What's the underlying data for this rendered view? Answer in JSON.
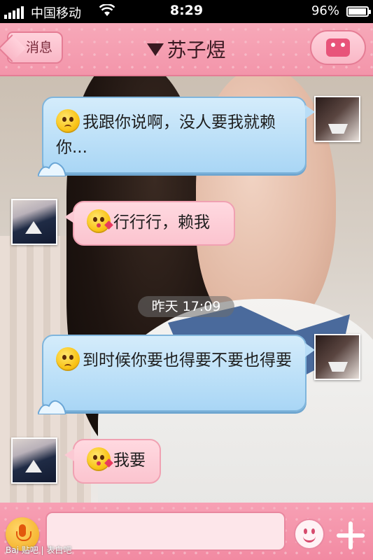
{
  "status_bar": {
    "carrier": "中国移动",
    "time": "8:29",
    "battery_percent": "96%"
  },
  "nav": {
    "back_label": "消息",
    "title": "苏子煜"
  },
  "messages": [
    {
      "side": "right",
      "text": "我跟你说啊，没人要我就赖你..."
    },
    {
      "side": "left",
      "text": "行行行，赖我"
    },
    {
      "side": "right",
      "text": "到时候你要也得要不要也得要"
    },
    {
      "side": "left",
      "text": "我要"
    }
  ],
  "timestamp": "昨天 17:09",
  "watermark": "Bai 贴吧 | 表白吧",
  "colors": {
    "nav_pink": "#f395aa",
    "bubble_blue": "#a9d6f5",
    "bubble_pink": "#fbc4cf"
  },
  "icons": [
    "signal-icon",
    "wifi-icon",
    "battery-icon",
    "menu-icon",
    "voice-icon",
    "emoji-icon",
    "plus-icon"
  ]
}
